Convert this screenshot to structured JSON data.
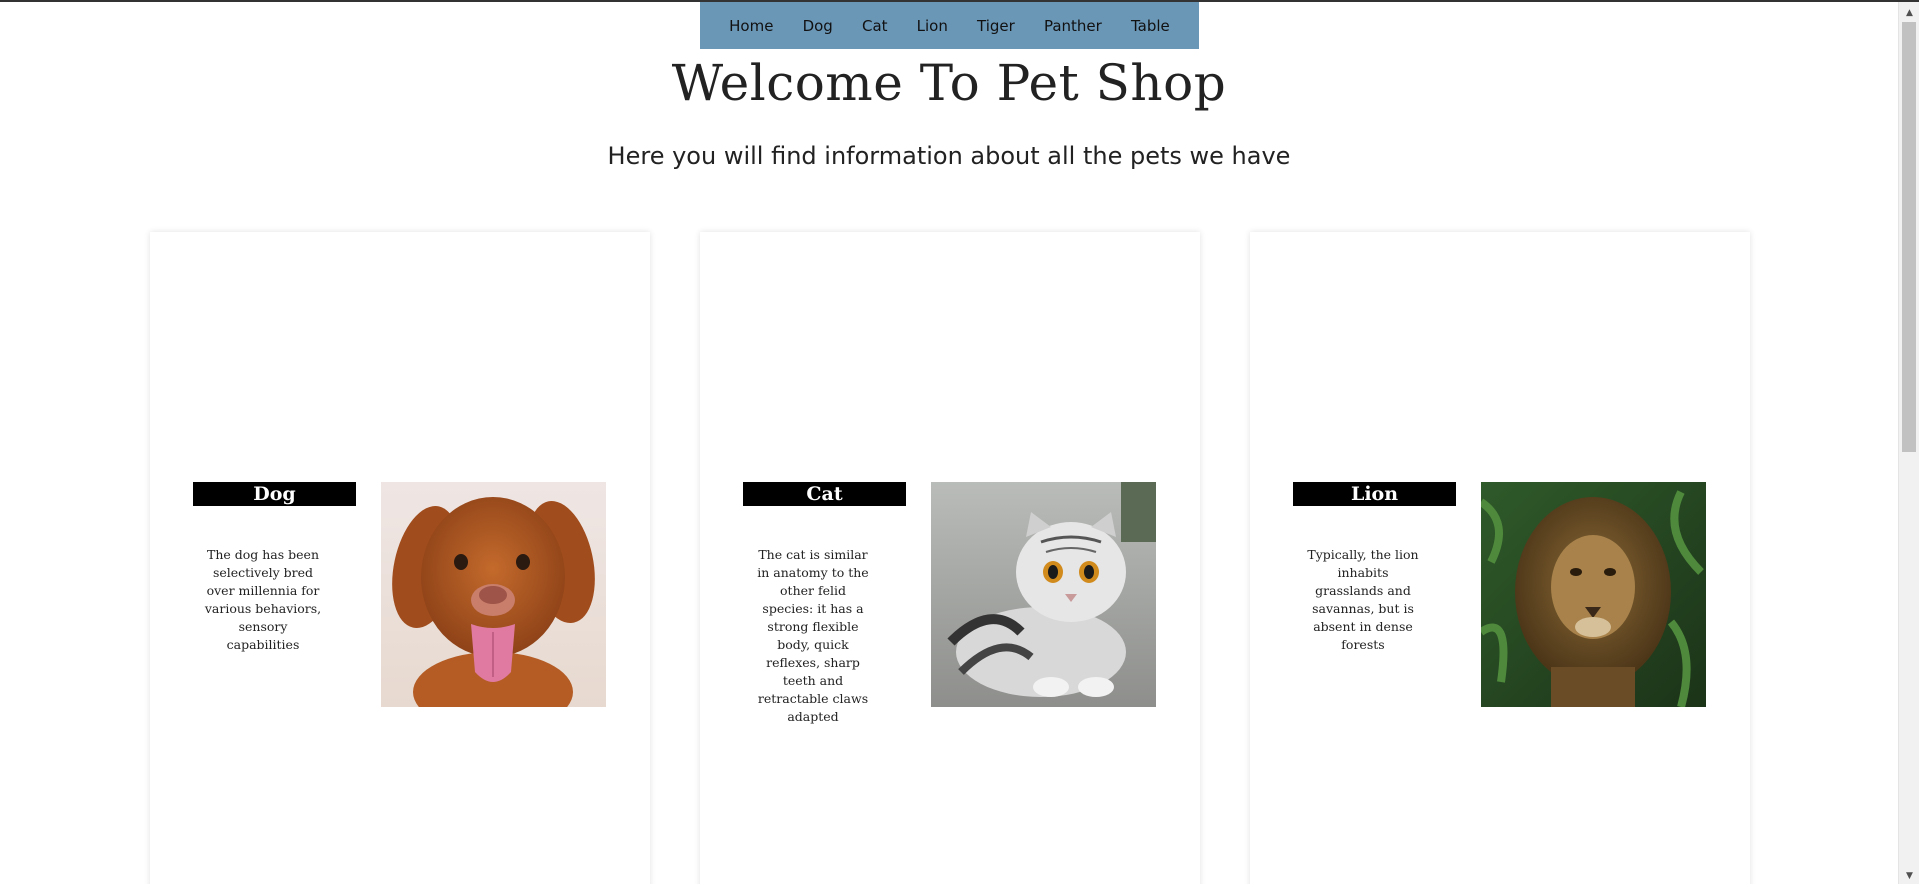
{
  "nav": {
    "items": [
      {
        "label": "Home"
      },
      {
        "label": "Dog"
      },
      {
        "label": "Cat"
      },
      {
        "label": "Lion"
      },
      {
        "label": "Tiger"
      },
      {
        "label": "Panther"
      },
      {
        "label": "Table"
      }
    ],
    "background": "#6b97b7"
  },
  "hero": {
    "title": "Welcome To Pet Shop",
    "subtitle": "Here you will find information about all the pets we have"
  },
  "cards": [
    {
      "name": "Dog",
      "description": "The dog has been selectively bred over millennia for various behaviors, sensory capabilities",
      "photo_icon": "dog-photo"
    },
    {
      "name": "Cat",
      "description": "The cat is similar in anatomy to the other felid species: it has a strong flexible body, quick reflexes, sharp teeth and retractable claws adapted",
      "photo_icon": "cat-photo"
    },
    {
      "name": "Lion",
      "description": "Typically, the lion inhabits grasslands and savannas, but is absent in dense forests",
      "photo_icon": "lion-photo"
    }
  ]
}
